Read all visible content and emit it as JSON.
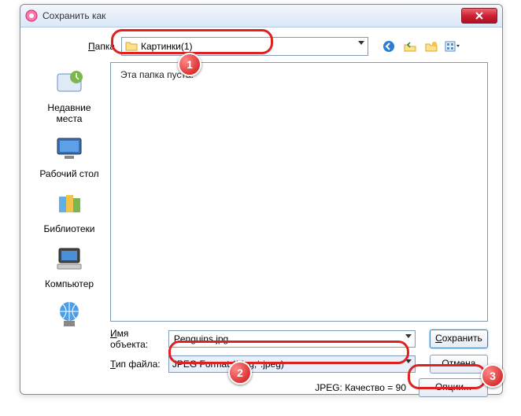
{
  "window": {
    "title": "Сохранить как"
  },
  "toprow": {
    "folder_label": "Папка",
    "folder_label_hotkey": "П",
    "folder_value": "Картинки(1)"
  },
  "listing": {
    "empty_text": "Эта папка пуста."
  },
  "places": {
    "recent": "Недавние места",
    "desktop": "Рабочий стол",
    "libraries": "Библиотеки",
    "computer": "Компьютер",
    "network": ""
  },
  "bottom": {
    "name_label": "Имя объекта:",
    "name_label_hotkey": "И",
    "name_value": "Penguins.jpg",
    "type_label": "Тип файла:",
    "type_label_hotkey": "Т",
    "type_value": "JPEG Format (*.jpg;*.jpeg)",
    "save_label": "Сохранить",
    "save_hotkey": "С",
    "cancel_label": "Отмена",
    "options_label": "Опции...",
    "quality_text": "JPEG: Качество = 90"
  },
  "markers": {
    "m1": "1",
    "m2": "2",
    "m3": "3"
  }
}
